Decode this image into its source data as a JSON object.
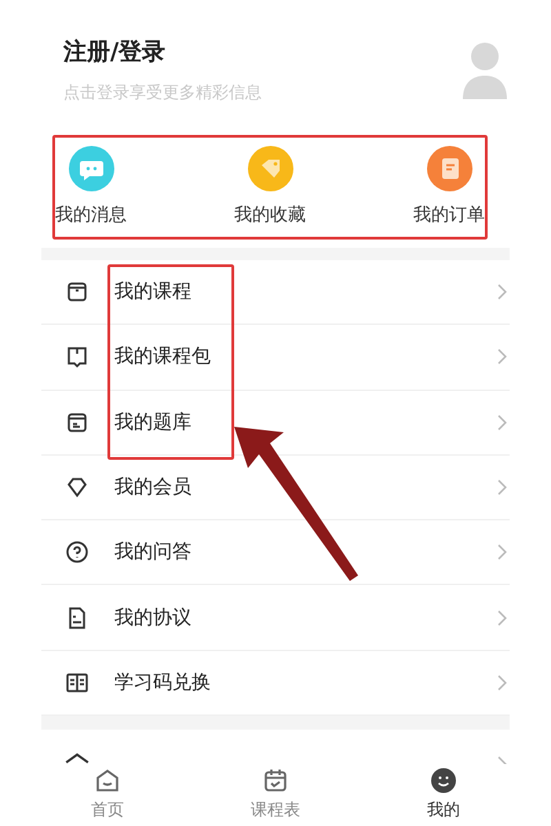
{
  "header": {
    "title": "注册/登录",
    "subtitle": "点击登录享受更多精彩信息"
  },
  "quick_links": [
    {
      "label": "我的消息",
      "kind": "message"
    },
    {
      "label": "我的收藏",
      "kind": "favorite"
    },
    {
      "label": "我的订单",
      "kind": "order"
    }
  ],
  "menu": [
    {
      "label": "我的课程",
      "kind": "course"
    },
    {
      "label": "我的课程包",
      "kind": "package"
    },
    {
      "label": "我的题库",
      "kind": "bank"
    },
    {
      "label": "我的会员",
      "kind": "member"
    },
    {
      "label": "我的问答",
      "kind": "qa"
    },
    {
      "label": "我的协议",
      "kind": "agreement"
    },
    {
      "label": "学习码兑换",
      "kind": "redeem"
    },
    {
      "kind": "settings"
    }
  ],
  "tabs": [
    {
      "label": "首页",
      "kind": "home",
      "selected": false
    },
    {
      "label": "课程表",
      "kind": "schedule",
      "selected": false
    },
    {
      "label": "我的",
      "kind": "mine",
      "selected": true
    }
  ]
}
